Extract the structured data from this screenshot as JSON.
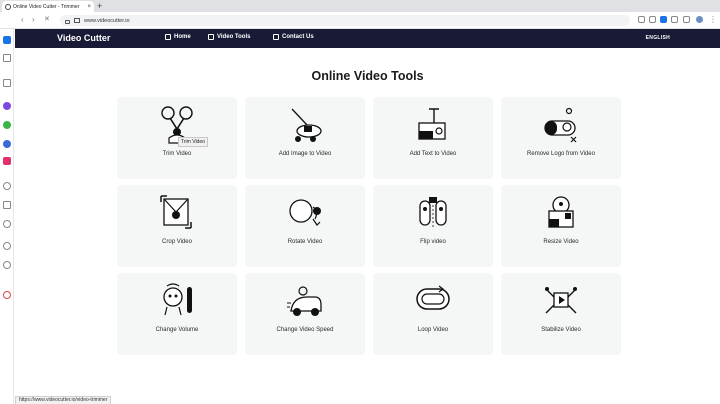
{
  "browser": {
    "tab_title": "Online Video Cutter - Trimmer",
    "tab_close": "×",
    "new_tab": "+",
    "url": "www.videocutter.io",
    "status_url": "https://www.videocutter.io/video-trimmer"
  },
  "nav": {
    "logo": "Video Cutter",
    "items": [
      {
        "label": "Home",
        "icon": "home-icon"
      },
      {
        "label": "Video Tools",
        "icon": "tools-icon"
      },
      {
        "label": "Contact Us",
        "icon": "mail-icon"
      }
    ],
    "language": "ENGLISH"
  },
  "main": {
    "heading": "Online Video Tools",
    "tooltip": "Trim Video",
    "tools": [
      {
        "label": "Trim Video",
        "icon": "scissors-icon"
      },
      {
        "label": "Add Image to Video",
        "icon": "add-image-icon"
      },
      {
        "label": "Add Text to Video",
        "icon": "add-text-icon"
      },
      {
        "label": "Remove Logo from Video",
        "icon": "remove-logo-icon"
      },
      {
        "label": "Crop Video",
        "icon": "crop-icon"
      },
      {
        "label": "Rotate Video",
        "icon": "rotate-icon"
      },
      {
        "label": "Flip video",
        "icon": "flip-icon"
      },
      {
        "label": "Resize Video",
        "icon": "resize-icon"
      },
      {
        "label": "Change Volume",
        "icon": "volume-icon"
      },
      {
        "label": "Change Video Speed",
        "icon": "speed-icon"
      },
      {
        "label": "Loop Video",
        "icon": "loop-icon"
      },
      {
        "label": "Stabilize Video",
        "icon": "stabilize-icon"
      }
    ]
  },
  "colors": {
    "nav_bg": "#191a35",
    "card_bg": "#f5f7f7",
    "accent": "#1a73e8"
  }
}
